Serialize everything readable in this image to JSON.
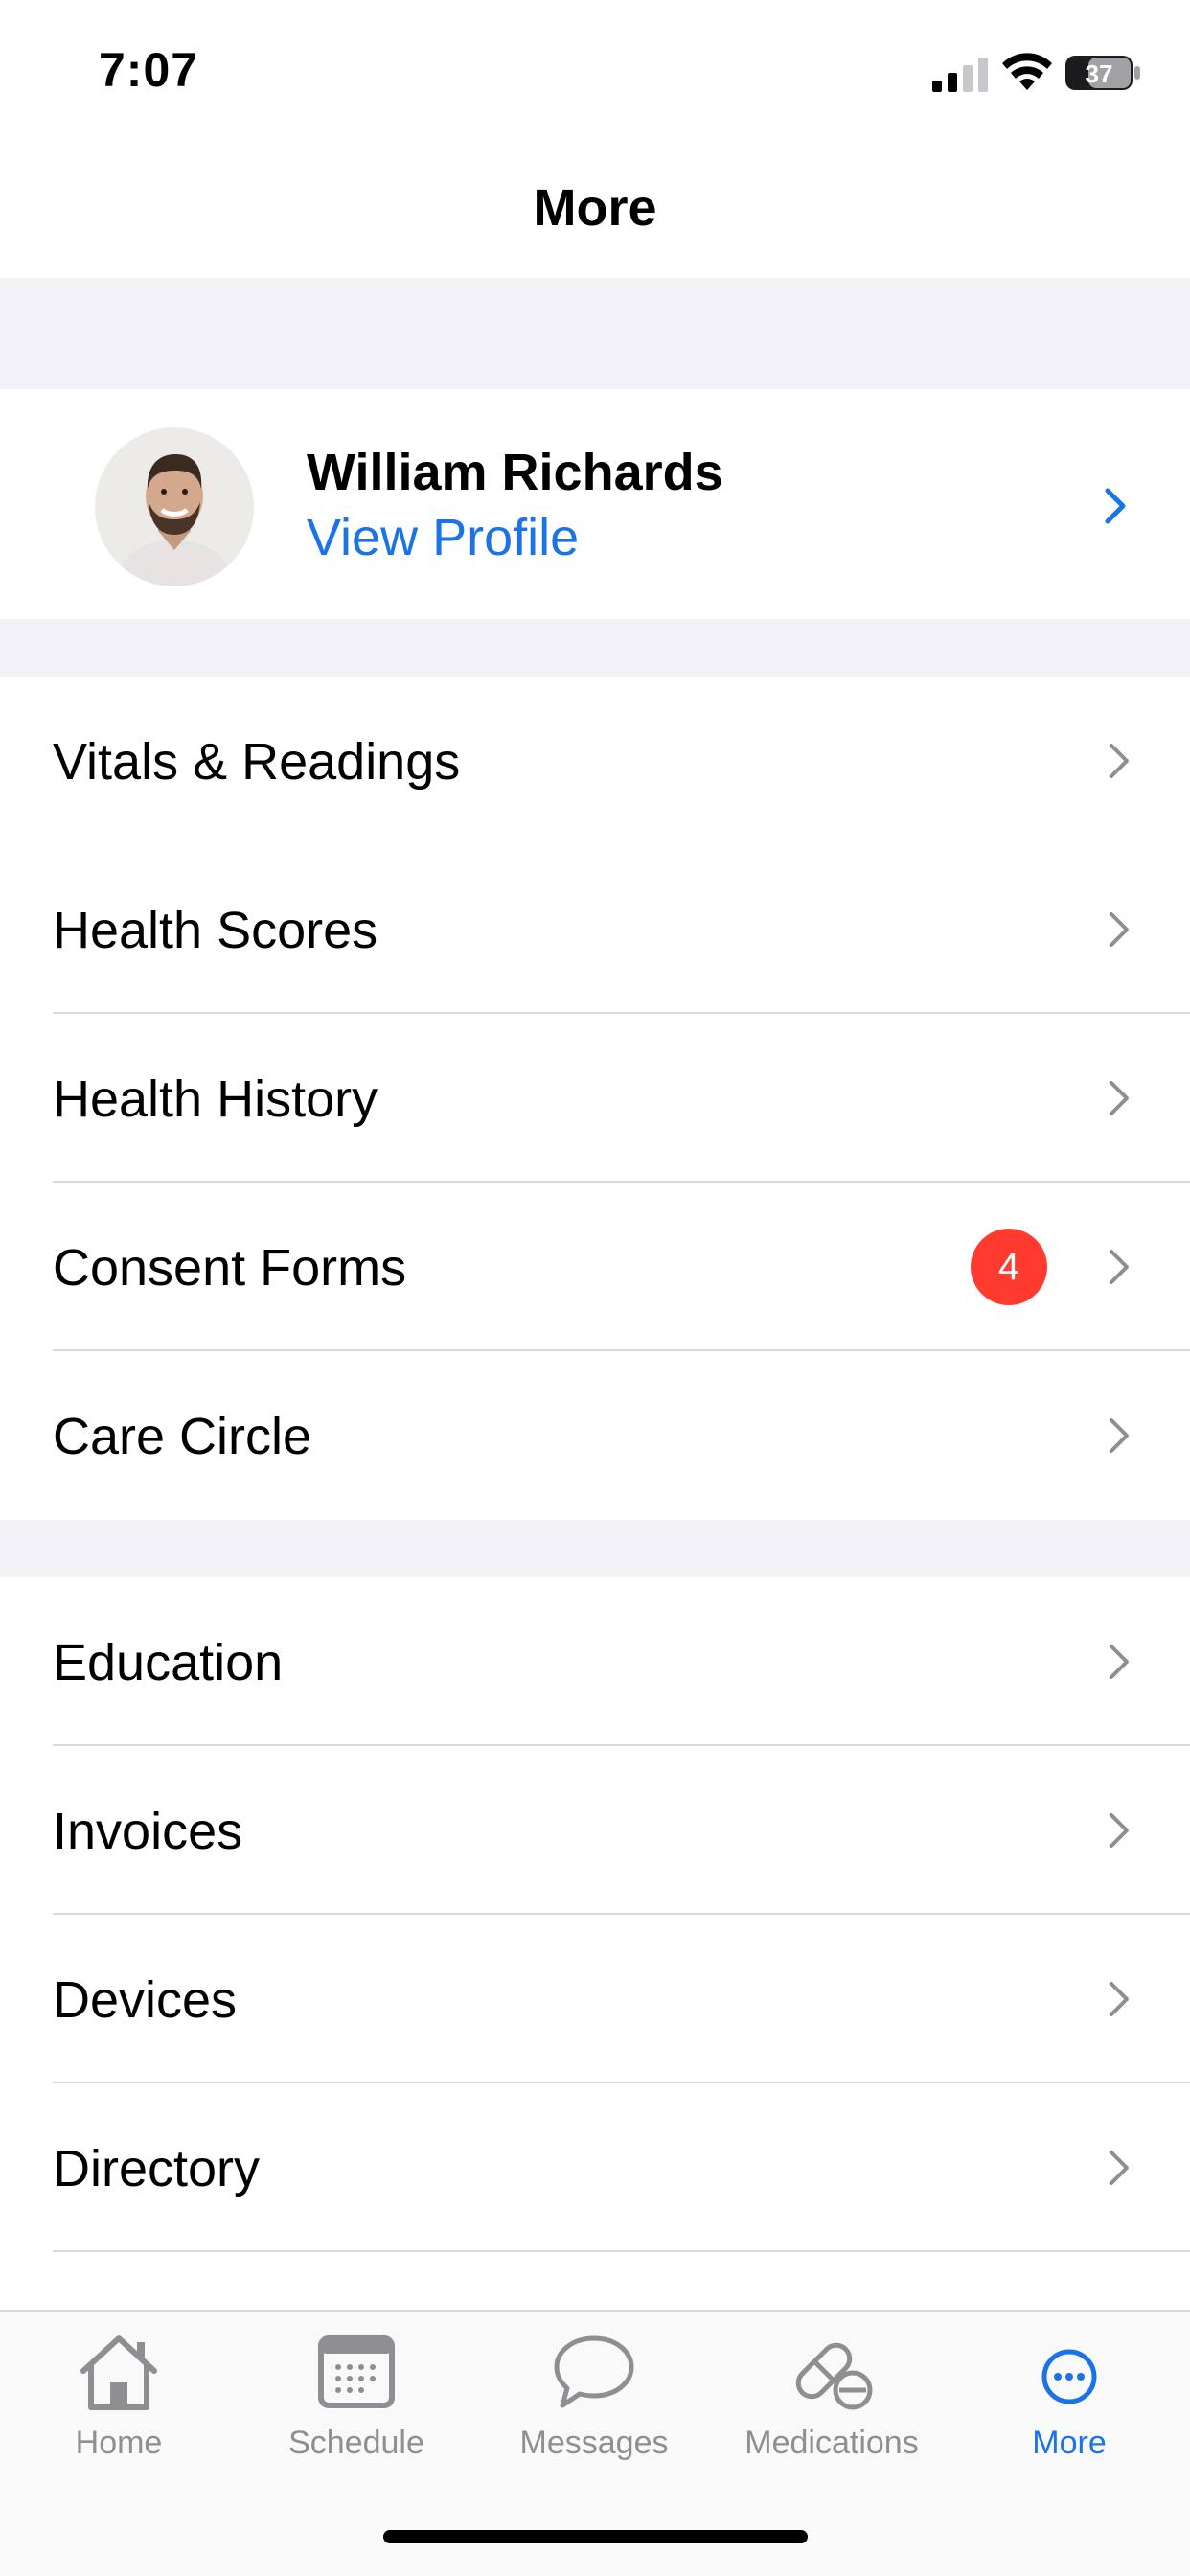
{
  "status_bar": {
    "time": "7:07",
    "battery": "37"
  },
  "header": {
    "title": "More"
  },
  "profile": {
    "name": "William Richards",
    "link_label": "View Profile"
  },
  "sections": [
    {
      "items": [
        {
          "label": "Vitals & Readings"
        },
        {
          "label": "Health Scores"
        },
        {
          "label": "Health History"
        },
        {
          "label": "Consent Forms",
          "badge": "4"
        },
        {
          "label": "Care Circle"
        }
      ]
    },
    {
      "items": [
        {
          "label": "Education"
        },
        {
          "label": "Invoices"
        },
        {
          "label": "Devices"
        },
        {
          "label": "Directory"
        }
      ]
    }
  ],
  "tab_bar": {
    "tabs": [
      {
        "label": "Home",
        "icon": "home-icon"
      },
      {
        "label": "Schedule",
        "icon": "calendar-icon"
      },
      {
        "label": "Messages",
        "icon": "message-bubble-icon"
      },
      {
        "label": "Medications",
        "icon": "pill-icon"
      },
      {
        "label": "More",
        "icon": "more-icon",
        "active": true
      }
    ]
  },
  "colors": {
    "accent": "#1a73e8",
    "badge": "#ff3b30",
    "section_gap": "#f2f2f7",
    "inactive_tab": "#8e8e93"
  }
}
